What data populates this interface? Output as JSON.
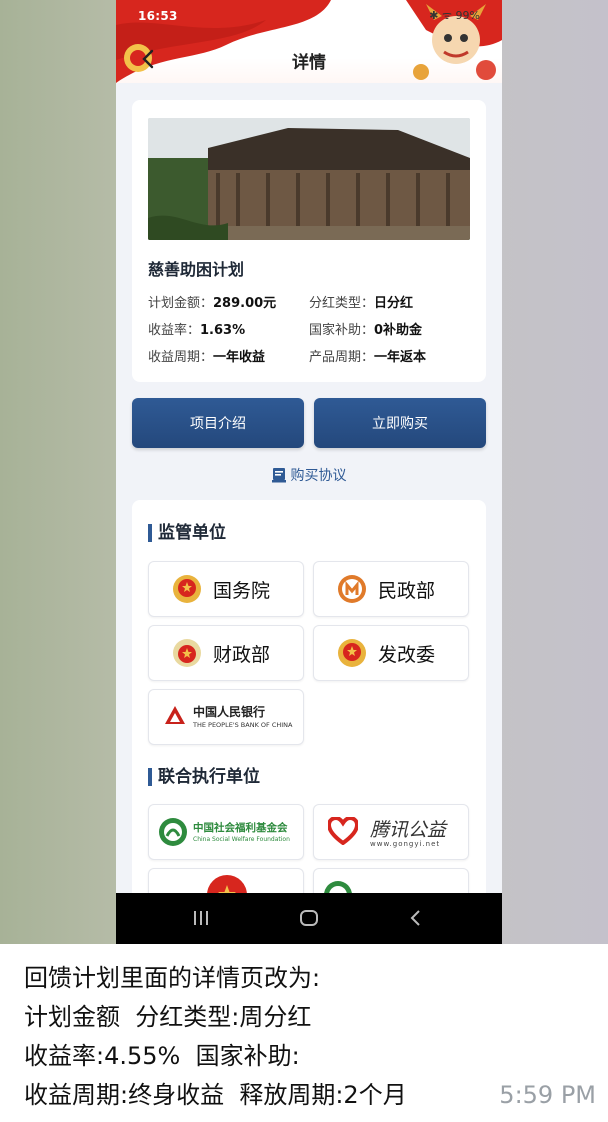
{
  "status": {
    "time": "16:53",
    "battery": "99%"
  },
  "header": {
    "title": "详情"
  },
  "plan": {
    "title": "慈善助困计划",
    "fields": [
      {
        "label": "计划金额：",
        "value": "289.00元"
      },
      {
        "label": "分红类型：",
        "value": "日分红"
      },
      {
        "label": "收益率：",
        "value": "1.63%"
      },
      {
        "label": "国家补助：",
        "value": "0补助金"
      },
      {
        "label": "收益周期：",
        "value": "一年收益"
      },
      {
        "label": "产品周期：",
        "value": "一年返本"
      }
    ]
  },
  "actions": {
    "intro": "项目介绍",
    "buy": "立即购买",
    "agreement": "购买协议"
  },
  "supervisors": {
    "title": "监管单位",
    "items": [
      "国务院",
      "民政部",
      "财政部",
      "发改委"
    ],
    "bank_cn": "中国人民银行",
    "bank_en": "THE PEOPLE'S BANK OF CHINA"
  },
  "executors": {
    "title": "联合执行单位",
    "welfare_cn": "中国社会福利基金会",
    "welfare_en": "China Social Welfare Foundation",
    "tencent_cn": "腾讯公益",
    "tencent_en": "www.gongyi.net"
  },
  "message": {
    "lines": [
      "回馈计划里面的详情页改为:",
      "计划金额  分红类型:周分红",
      "收益率:4.55%  国家补助:",
      "收益周期:终身收益  释放周期:2个月"
    ],
    "time": "5:59 PM"
  },
  "colors": {
    "accent": "#2f5a95",
    "banner_red": "#d7261e"
  }
}
